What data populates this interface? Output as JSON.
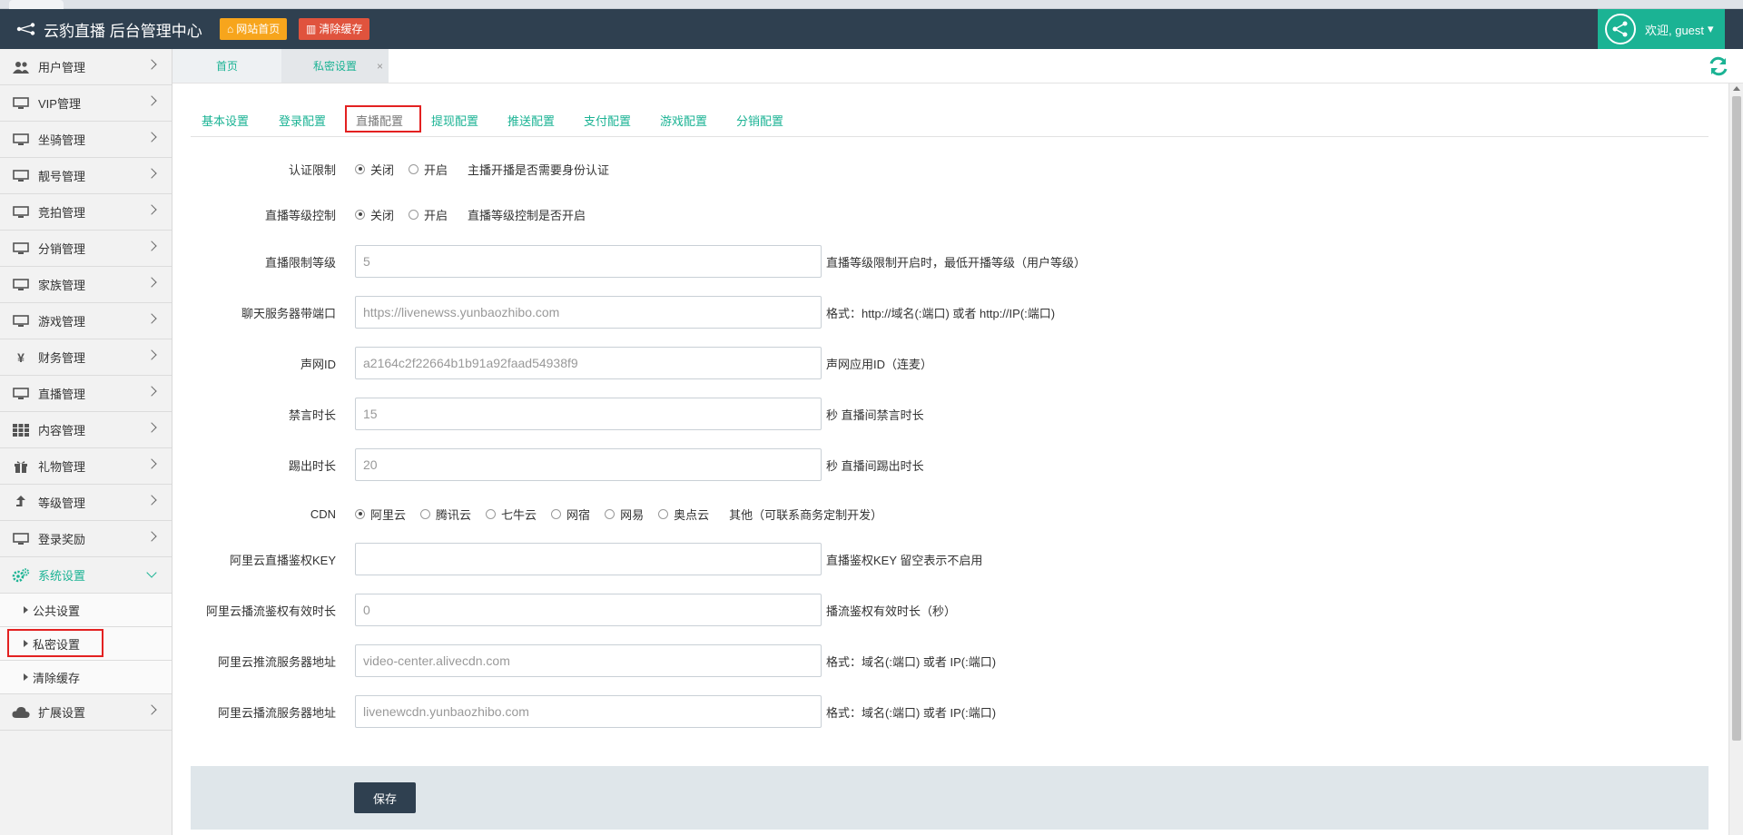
{
  "header": {
    "title": "云豹直播 后台管理中心",
    "home_btn": "网站首页",
    "clear_btn": "清除缓存",
    "welcome": "欢迎, guest"
  },
  "sidebar": {
    "items": [
      {
        "label": "用户管理",
        "icon": "users-icon"
      },
      {
        "label": "VIP管理",
        "icon": "monitor-icon"
      },
      {
        "label": "坐骑管理",
        "icon": "monitor-icon"
      },
      {
        "label": "靓号管理",
        "icon": "monitor-icon"
      },
      {
        "label": "竞拍管理",
        "icon": "monitor-icon"
      },
      {
        "label": "分销管理",
        "icon": "monitor-icon"
      },
      {
        "label": "家族管理",
        "icon": "monitor-icon"
      },
      {
        "label": "游戏管理",
        "icon": "monitor-icon"
      },
      {
        "label": "财务管理",
        "icon": "yen-icon"
      },
      {
        "label": "直播管理",
        "icon": "monitor-icon"
      },
      {
        "label": "内容管理",
        "icon": "grid-icon"
      },
      {
        "label": "礼物管理",
        "icon": "gift-icon"
      },
      {
        "label": "等级管理",
        "icon": "level-arrow-icon"
      },
      {
        "label": "登录奖励",
        "icon": "monitor-icon"
      },
      {
        "label": "系统设置",
        "icon": "gears-icon"
      }
    ],
    "sub_items": [
      "公共设置",
      "私密设置",
      "清除缓存"
    ],
    "last_item": {
      "label": "扩展设置",
      "icon": "cloud-icon"
    }
  },
  "tabs": {
    "home": "首页",
    "private": "私密设置",
    "close": "×"
  },
  "subtabs": [
    "基本设置",
    "登录配置",
    "直播配置",
    "提现配置",
    "推送配置",
    "支付配置",
    "游戏配置",
    "分销配置"
  ],
  "form": {
    "auth_limit": {
      "label": "认证限制",
      "off": "关闭",
      "on": "开启",
      "selected": "关闭",
      "hint": "主播开播是否需要身份认证"
    },
    "level_control": {
      "label": "直播等级控制",
      "off": "关闭",
      "on": "开启",
      "selected": "关闭",
      "hint": "直播等级控制是否开启"
    },
    "level_limit": {
      "label": "直播限制等级",
      "value": "5",
      "hint": "直播等级限制开启时，最低开播等级（用户等级）"
    },
    "chat_server": {
      "label": "聊天服务器带端口",
      "value": "https://livenewss.yunbaozhibo.com",
      "hint": "格式：http://域名(:端口) 或者 http://IP(:端口)"
    },
    "agora_id": {
      "label": "声网ID",
      "value": "a2164c2f22664b1b91a92faad54938f9",
      "hint": "声网应用ID（连麦）"
    },
    "mute_time": {
      "label": "禁言时长",
      "value": "15",
      "hint": "秒 直播间禁言时长"
    },
    "kick_time": {
      "label": "踢出时长",
      "value": "20",
      "hint": "秒 直播间踢出时长"
    },
    "cdn": {
      "label": "CDN",
      "options": [
        "阿里云",
        "腾讯云",
        "七牛云",
        "网宿",
        "网易",
        "奥点云"
      ],
      "selected": "阿里云",
      "hint": "其他（可联系商务定制开发）"
    },
    "aliyun_key": {
      "label": "阿里云直播鉴权KEY",
      "value": "",
      "hint": "直播鉴权KEY 留空表示不启用"
    },
    "aliyun_expire": {
      "label": "阿里云播流鉴权有效时长",
      "value": "0",
      "hint": "播流鉴权有效时长（秒）"
    },
    "aliyun_push": {
      "label": "阿里云推流服务器地址",
      "value": "video-center.alivecdn.com",
      "hint": "格式：域名(:端口) 或者 IP(:端口)"
    },
    "aliyun_pull": {
      "label": "阿里云播流服务器地址",
      "value": "livenewcdn.yunbaozhibo.com",
      "hint": "格式：域名(:端口) 或者 IP(:端口)"
    }
  },
  "save": "保存",
  "colors": {
    "topbar": "#2f4050",
    "accent": "#1bb394",
    "orange": "#f7a51c",
    "red": "#e0533d"
  }
}
